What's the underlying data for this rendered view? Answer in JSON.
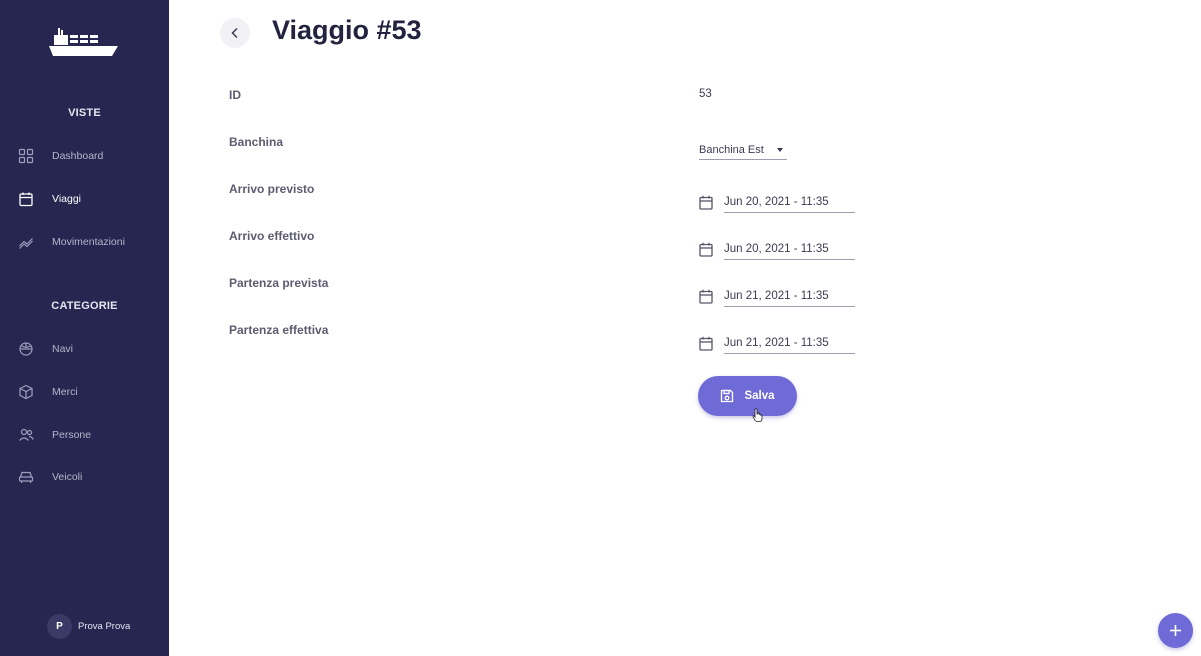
{
  "sidebar": {
    "views_title": "VISTE",
    "views": [
      {
        "label": "Dashboard",
        "icon": "grid-icon"
      },
      {
        "label": "Viaggi",
        "icon": "calendar-icon",
        "active": true
      },
      {
        "label": "Movimentazioni",
        "icon": "trend-icon"
      }
    ],
    "categories_title": "CATEGORIE",
    "categories": [
      {
        "label": "Navi",
        "icon": "ship-wheel-icon"
      },
      {
        "label": "Merci",
        "icon": "box-icon"
      },
      {
        "label": "Persone",
        "icon": "users-icon"
      },
      {
        "label": "Veicoli",
        "icon": "car-icon"
      }
    ],
    "user": {
      "initial": "P",
      "name": "Prova Prova"
    }
  },
  "header": {
    "title": "Viaggio #53"
  },
  "form": {
    "id_label": "ID",
    "id_value": "53",
    "banchina_label": "Banchina",
    "banchina_value": "Banchina Est",
    "arrivo_previsto_label": "Arrivo previsto",
    "arrivo_previsto_value": "Jun 20, 2021 - 11:35",
    "arrivo_effettivo_label": "Arrivo effettivo",
    "arrivo_effettivo_value": "Jun 20, 2021 - 11:35",
    "partenza_prevista_label": "Partenza prevista",
    "partenza_prevista_value": "Jun 21, 2021 - 11:35",
    "partenza_effettiva_label": "Partenza effettiva",
    "partenza_effettiva_value": "Jun 21, 2021 - 11:35",
    "save_label": "Salva"
  },
  "colors": {
    "sidebar_bg": "#262650",
    "accent": "#6e6ad6",
    "title": "#23233f"
  }
}
